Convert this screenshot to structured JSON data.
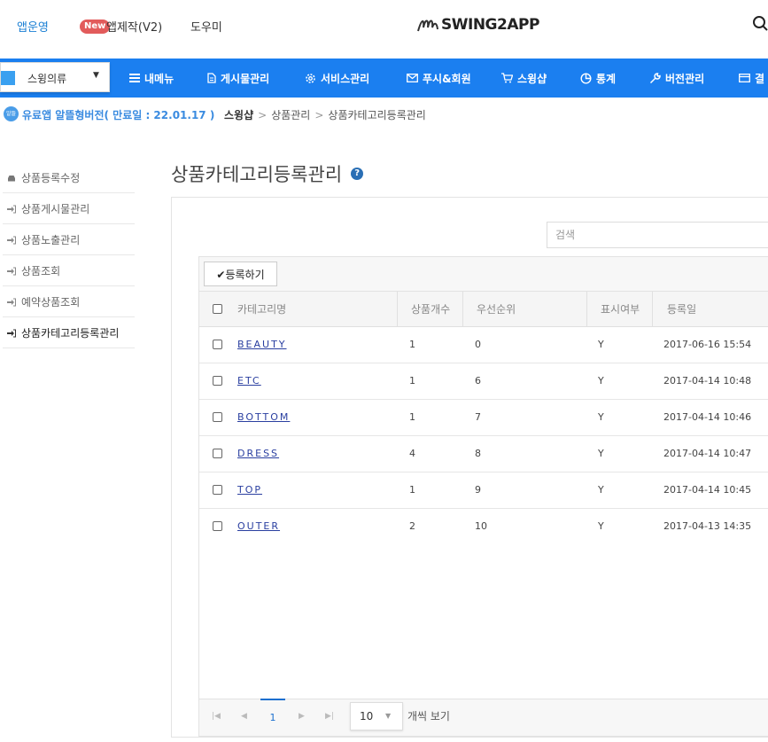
{
  "header": {
    "links": [
      "앱운영",
      "앱제작(V2)",
      "도우미"
    ],
    "new_badge": "New",
    "logo_text": "SWING2APP"
  },
  "nav": {
    "app_select": "스윙의류",
    "items": [
      "내메뉴",
      "게시물관리",
      "서비스관리",
      "푸시&회원",
      "스윙샵",
      "통계",
      "버전관리",
      "결"
    ]
  },
  "subbar": {
    "plan_icon": "알뜰",
    "plan": "유료앱 알뜰형버전( 만료일 : 22.01.17 )",
    "breadcrumbs": [
      "스윙샵",
      "상품관리",
      "상품카테고리등록관리"
    ]
  },
  "sidebar": {
    "items": [
      "상품등록수정",
      "상품게시물관리",
      "상품노출관리",
      "상품조회",
      "예약상품조회",
      "상품카테고리등록관리"
    ],
    "active_index": 5
  },
  "main": {
    "title": "상품카테고리등록관리",
    "search_placeholder": "검색",
    "register_button": "✔등록하기",
    "columns": [
      "카테고리명",
      "상품개수",
      "우선순위",
      "표시여부",
      "등록일"
    ],
    "rows": [
      {
        "name": "BEAUTY",
        "count": "1",
        "priority": "0",
        "visible": "Y",
        "date": "2017-06-16 15:54"
      },
      {
        "name": "ETC",
        "count": "1",
        "priority": "6",
        "visible": "Y",
        "date": "2017-04-14 10:48"
      },
      {
        "name": "BOTTOM",
        "count": "1",
        "priority": "7",
        "visible": "Y",
        "date": "2017-04-14 10:46"
      },
      {
        "name": "DRESS",
        "count": "4",
        "priority": "8",
        "visible": "Y",
        "date": "2017-04-14 10:47"
      },
      {
        "name": "TOP",
        "count": "1",
        "priority": "9",
        "visible": "Y",
        "date": "2017-04-14 10:45"
      },
      {
        "name": "OUTER",
        "count": "2",
        "priority": "10",
        "visible": "Y",
        "date": "2017-04-13 14:35"
      }
    ],
    "pager": {
      "current_page": "1",
      "page_size": "10",
      "per_page_label": "개씩 보기"
    }
  },
  "colors": {
    "nav_blue": "#1b7ff0",
    "link_blue": "#1a7fd4",
    "badge_red": "#e25b5b"
  }
}
